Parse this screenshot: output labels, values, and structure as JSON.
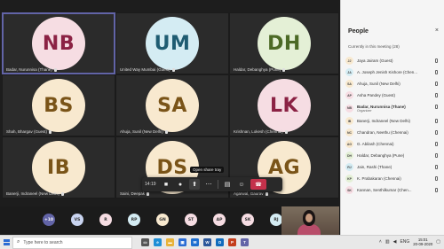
{
  "tiles": [
    {
      "initials": "NB",
      "bg": "#f6dde3",
      "fg": "#8b2244",
      "name": "Badar, Nurunnisa (Thane)",
      "active": true
    },
    {
      "initials": "UM",
      "bg": "#d4ecf3",
      "fg": "#1f5c72",
      "name": "United Way Mumbai (Guest)",
      "active": false
    },
    {
      "initials": "DH",
      "bg": "#e4f0d6",
      "fg": "#4c6a26",
      "name": "Haldar, Debanghya (Pune)",
      "active": false
    },
    {
      "initials": "BS",
      "bg": "#f8e9cf",
      "fg": "#7a5418",
      "name": "Shah, Bhargav (Guest)",
      "active": false
    },
    {
      "initials": "SA",
      "bg": "#f8e9cf",
      "fg": "#7a5418",
      "name": "Ahuja, Sunil (New Delhi)",
      "active": false
    },
    {
      "initials": "LK",
      "bg": "#f6dde3",
      "fg": "#8b2244",
      "name": "Krishnan, Lokesh (Chennai)",
      "active": false
    },
    {
      "initials": "IB",
      "bg": "#f8e9cf",
      "fg": "#7a5418",
      "name": "Banerji, Indraneel (New Delhi)",
      "active": false
    },
    {
      "initials": "DS",
      "bg": "#f8e9cf",
      "fg": "#7a5418",
      "name": "Saini, Deepak",
      "active": false
    },
    {
      "initials": "AG",
      "bg": "#f8e9cf",
      "fg": "#7a5418",
      "name": "Agarwal, Gaurav",
      "active": false
    }
  ],
  "callbar": {
    "time": "14:19",
    "tooltip": "Open share tray",
    "icons": [
      "video-icon",
      "mic-icon",
      "share-tray-icon",
      "more-options-icon",
      "chat-icon",
      "participants-icon",
      "hang-up-icon"
    ]
  },
  "strip": [
    {
      "label": "+10",
      "bg": "#6264a7",
      "fg": "#ffffff"
    },
    {
      "label": "VS",
      "bg": "#c9d4f0",
      "fg": "#333333"
    },
    {
      "label": "R",
      "bg": "#f6dde3",
      "fg": "#333333"
    },
    {
      "label": "RP",
      "bg": "#d4ecf3",
      "fg": "#333333"
    },
    {
      "label": "GN",
      "bg": "#f8e9cf",
      "fg": "#333333"
    },
    {
      "label": "ST",
      "bg": "#f6dde3",
      "fg": "#333333"
    },
    {
      "label": "AP",
      "bg": "#f6dde3",
      "fg": "#333333"
    },
    {
      "label": "SK",
      "bg": "#f6dde3",
      "fg": "#333333"
    },
    {
      "label": "RJ",
      "bg": "#d4ecf3",
      "fg": "#333333"
    }
  ],
  "people": {
    "title": "People",
    "close": "×",
    "section": "Currently in this meeting (28)",
    "list": [
      {
        "initials": "JJ",
        "name": "Jaya Jairam (Guest)",
        "bg": "#f8e9cf",
        "organizer": false
      },
      {
        "initials": "JA",
        "name": "A. Joseph Jenish Kishore (Chen...",
        "bg": "#d4ecf3",
        "organizer": false
      },
      {
        "initials": "SA",
        "name": "Ahuja, Sunil (New Delhi)",
        "bg": "#f8e9cf",
        "organizer": false
      },
      {
        "initials": "AP",
        "name": "Asha Pandey (Guest)",
        "bg": "#f6dde3",
        "organizer": false
      },
      {
        "initials": "NB",
        "name": "Badar, Nurunnisa (Thane)",
        "role": "Organizer",
        "bg": "#f6dde3",
        "organizer": true
      },
      {
        "initials": "IB",
        "name": "Banerji, Indraneel (New Delhi)",
        "bg": "#f8e9cf",
        "organizer": false
      },
      {
        "initials": "NC",
        "name": "Chandran, Neethu (Chennai)",
        "bg": "#f8e9cf",
        "organizer": false
      },
      {
        "initials": "AG",
        "name": "G. Abilash (Chennai)",
        "bg": "#f8e9cf",
        "organizer": false
      },
      {
        "initials": "DH",
        "name": "Haldar, Debanghya (Pune)",
        "bg": "#e4f0d6",
        "organizer": false
      },
      {
        "initials": "RJ",
        "name": "Jain, Rashi (Thane)",
        "bg": "#d4ecf3",
        "organizer": false
      },
      {
        "initials": "KP",
        "name": "K. Prabakaran (Chennai)",
        "bg": "#e4f0d6",
        "organizer": false
      },
      {
        "initials": "SK",
        "name": "Kannan, Senthilkumar (Chen...",
        "bg": "#f6dde3",
        "organizer": false
      }
    ]
  },
  "taskbar": {
    "search_placeholder": "Type here to search",
    "apps": [
      {
        "icon": "task-view-icon",
        "color": "#555555",
        "glyph": "▭"
      },
      {
        "icon": "edge-icon",
        "color": "#1f8fd6",
        "glyph": "e"
      },
      {
        "icon": "file-explorer-icon",
        "color": "#e8b33a",
        "glyph": "▬"
      },
      {
        "icon": "store-icon",
        "color": "#2b6cd4",
        "glyph": "▣"
      },
      {
        "icon": "mail-icon",
        "color": "#1f6fd0",
        "glyph": "✉"
      },
      {
        "icon": "word-icon",
        "color": "#2b579a",
        "glyph": "W"
      },
      {
        "icon": "outlook-icon",
        "color": "#0f6cbd",
        "glyph": "O"
      },
      {
        "icon": "powerpoint-icon",
        "color": "#c43e1c",
        "glyph": "P"
      },
      {
        "icon": "teams-icon",
        "color": "#6264a7",
        "glyph": "T"
      }
    ],
    "lang": "ENG",
    "time": "15:01",
    "date": "20-09-2020"
  }
}
